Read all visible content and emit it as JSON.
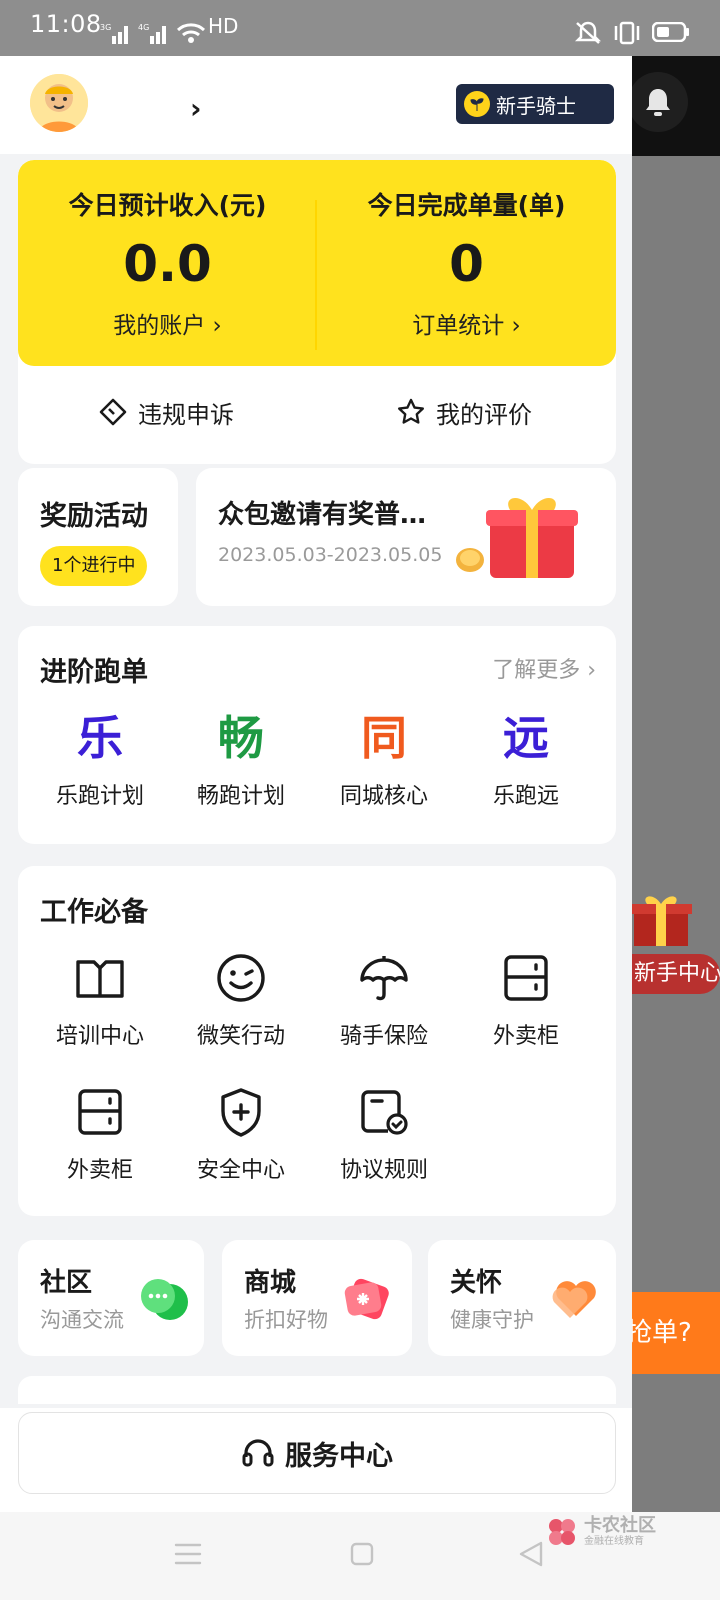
{
  "status_bar": {
    "time": "11:08",
    "network_1": "3G",
    "network_2": "4G",
    "hd": "HD"
  },
  "header": {
    "badge": "新手骑士"
  },
  "income": {
    "left_label": "今日预计收入(元)",
    "left_value": "0.0",
    "left_link": "我的账户 ›",
    "right_label": "今日完成单量(单)",
    "right_value": "0",
    "right_link": "订单统计 ›",
    "appeal": "违规申诉",
    "review": "我的评价"
  },
  "reward": {
    "title": "奖励活动",
    "badge": "1个进行中"
  },
  "invite": {
    "title": "众包邀请有奖普…",
    "date": "2023.05.03-2023.05.05"
  },
  "advanced": {
    "title": "进阶跑单",
    "more": "了解更多 ›",
    "items": [
      {
        "glyph": "乐",
        "label": "乐跑计划",
        "color": "#3b1fd6"
      },
      {
        "glyph": "畅",
        "label": "畅跑计划",
        "color": "#1e9a43"
      },
      {
        "glyph": "同",
        "label": "同城核心",
        "color": "#f05a1e"
      },
      {
        "glyph": "远",
        "label": "乐跑远",
        "color": "#3b1fd6"
      }
    ]
  },
  "work": {
    "title": "工作必备",
    "tools": [
      {
        "label": "培训中心",
        "icon": "book-icon"
      },
      {
        "label": "微笑行动",
        "icon": "smile-icon"
      },
      {
        "label": "骑手保险",
        "icon": "umbrella-icon"
      },
      {
        "label": "外卖柜",
        "icon": "locker-icon"
      },
      {
        "label": "外卖柜",
        "icon": "locker-icon"
      },
      {
        "label": "安全中心",
        "icon": "shield-plus-icon"
      },
      {
        "label": "协议规则",
        "icon": "document-check-icon"
      }
    ]
  },
  "mini": [
    {
      "title": "社区",
      "sub": "沟通交流",
      "icon": "chat-bubbles-icon"
    },
    {
      "title": "商城",
      "sub": "折扣好物",
      "icon": "tag-icon"
    },
    {
      "title": "关怀",
      "sub": "健康守护",
      "icon": "heart-icon"
    }
  ],
  "service": {
    "label": "服务中心"
  },
  "background": {
    "newbie": "新手中心",
    "orange": "抢单?"
  },
  "watermark": {
    "name": "卡农社区",
    "tagline": "金融在线教育"
  },
  "colors": {
    "yellow": "#ffe21e",
    "badge_bg": "#1f2a44"
  }
}
